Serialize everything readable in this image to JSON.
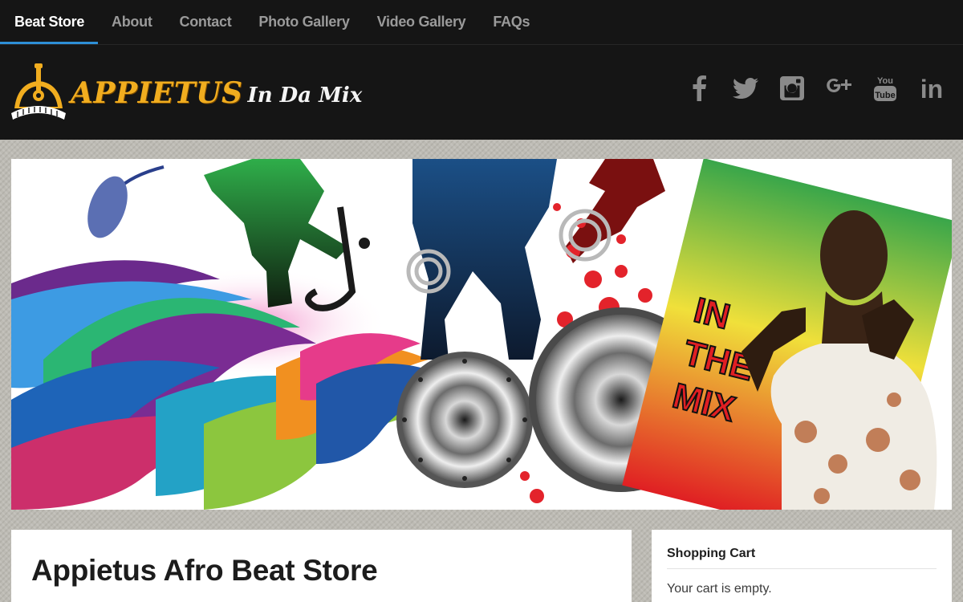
{
  "nav": {
    "items": [
      {
        "label": "Beat Store",
        "active": true
      },
      {
        "label": "About",
        "active": false
      },
      {
        "label": "Contact",
        "active": false
      },
      {
        "label": "Photo Gallery",
        "active": false
      },
      {
        "label": "Video Gallery",
        "active": false
      },
      {
        "label": "FAQs",
        "active": false
      }
    ],
    "active_color": "#2e8fd6"
  },
  "header": {
    "logo_main": "APPIETUS",
    "logo_sub": "In Da Mix",
    "logo_color": "#f1ad1f",
    "social": [
      {
        "icon": "facebook-icon"
      },
      {
        "icon": "twitter-icon"
      },
      {
        "icon": "instagram-icon"
      },
      {
        "icon": "google-plus-icon"
      },
      {
        "icon": "youtube-icon",
        "text_top": "You",
        "text_bottom": "Tube"
      },
      {
        "icon": "linkedin-icon",
        "text": "in"
      }
    ]
  },
  "hero": {
    "sign_lines": [
      "IN",
      "THE",
      "MIX"
    ]
  },
  "main": {
    "title": "Appietus Afro Beat Store"
  },
  "sidebar": {
    "cart_title": "Shopping Cart",
    "cart_empty": "Your cart is empty."
  }
}
